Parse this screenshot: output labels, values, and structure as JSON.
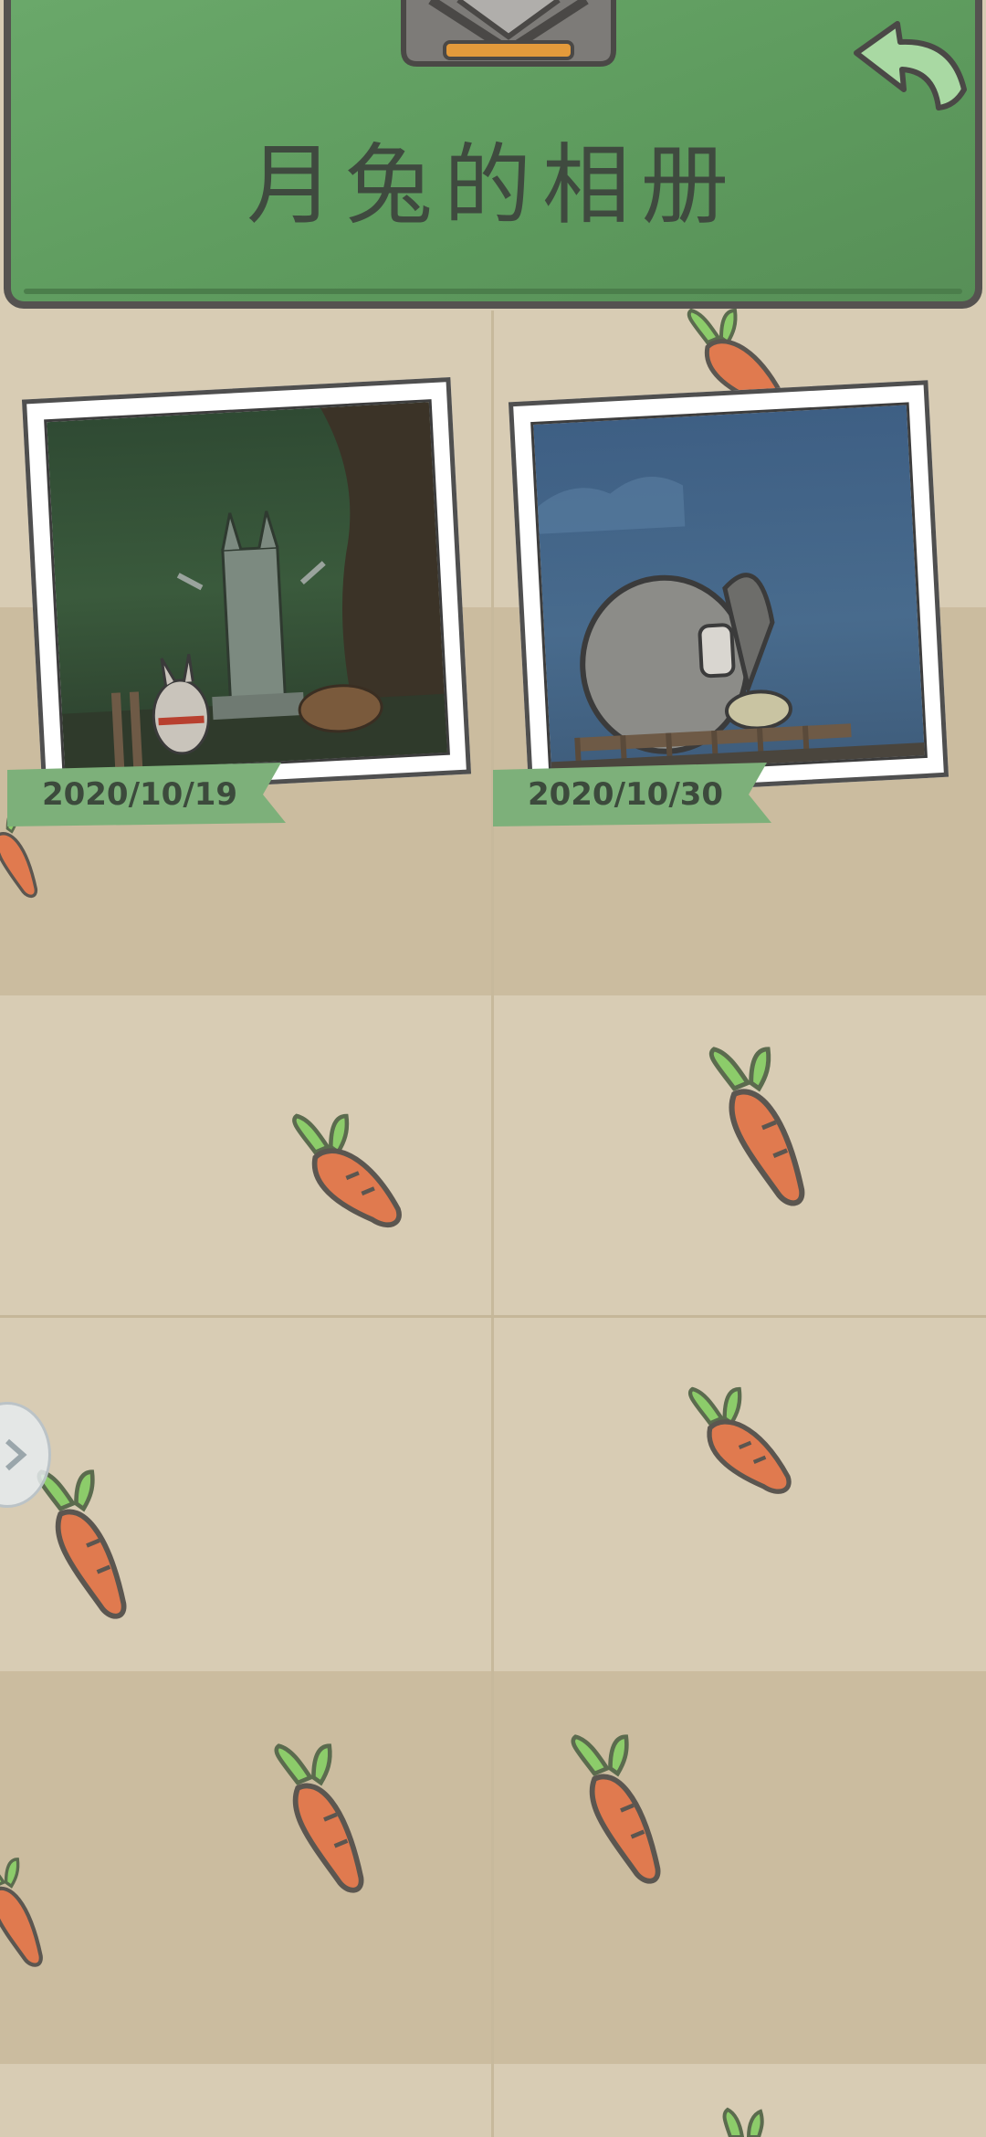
{
  "header": {
    "title": "月兔的相册",
    "back_icon": "back-arrow-icon"
  },
  "photos": [
    {
      "date": "2020/10/19",
      "scene": "rabbit-memorial-forest"
    },
    {
      "date": "2020/10/30",
      "scene": "rabbit-cannon-night"
    }
  ],
  "colors": {
    "header_green": "#5d9a5d",
    "ribbon_green": "#7db07a",
    "background_light": "#d8ccb4",
    "background_dark": "#cbbc9f",
    "carrot_orange": "#e07a4f",
    "leaf_green": "#8ccc6a"
  },
  "decorations": {
    "carrot_icon": "carrot-icon",
    "side_handle_icon": "chevron-right-icon"
  }
}
